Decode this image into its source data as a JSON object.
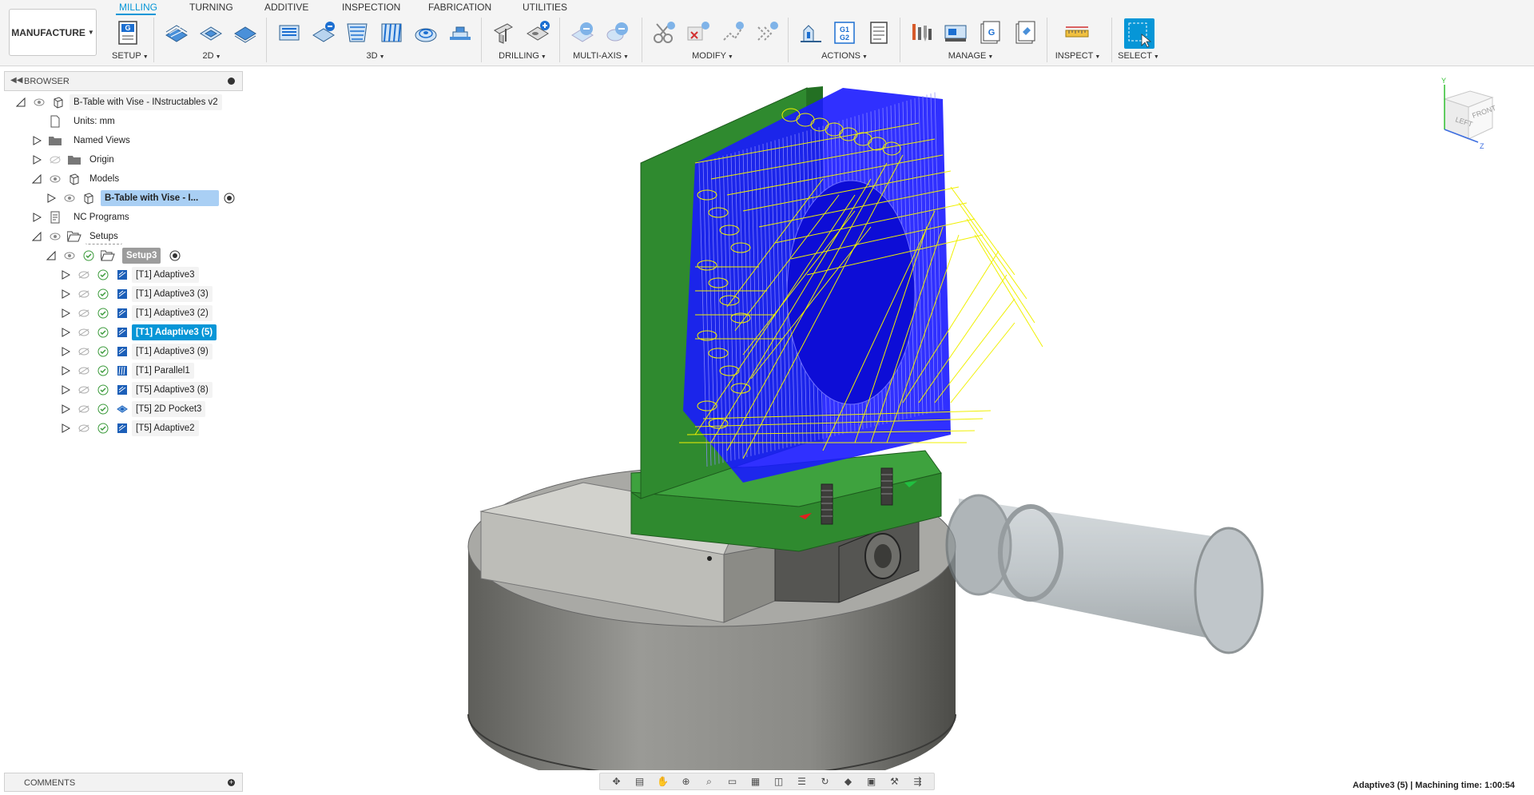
{
  "workspace": {
    "label": "MANUFACTURE"
  },
  "tabs": [
    {
      "label": "MILLING",
      "active": true
    },
    {
      "label": "TURNING"
    },
    {
      "label": "ADDITIVE"
    },
    {
      "label": "INSPECTION"
    },
    {
      "label": "FABRICATION"
    },
    {
      "label": "UTILITIES"
    }
  ],
  "groups": {
    "setup": "SETUP",
    "twod": "2D",
    "threed": "3D",
    "drilling": "DRILLING",
    "multiaxis": "MULTI-AXIS",
    "modify": "MODIFY",
    "actions": "ACTIONS",
    "manage": "MANAGE",
    "inspect": "INSPECT",
    "select": "SELECT"
  },
  "toolbar_icons": {
    "g_setup": "G",
    "g1": "G1",
    "g2": "G2",
    "g_manage": "G"
  },
  "browser": {
    "title": "BROWSER",
    "root": "B-Table with Vise - INstructables v2",
    "units": "Units: mm",
    "named_views": "Named Views",
    "origin": "Origin",
    "models": "Models",
    "model_item": "B-Table with Vise - I...",
    "nc_programs": "NC Programs",
    "setups": "Setups",
    "setup3": "Setup3",
    "ops": [
      {
        "label": "[T1] Adaptive3",
        "kind": "adaptive"
      },
      {
        "label": "[T1] Adaptive3 (3)",
        "kind": "adaptive"
      },
      {
        "label": "[T1] Adaptive3 (2)",
        "kind": "adaptive"
      },
      {
        "label": "[T1] Adaptive3 (5)",
        "kind": "adaptive",
        "selected": true
      },
      {
        "label": "[T1] Adaptive3 (9)",
        "kind": "adaptive"
      },
      {
        "label": "[T1] Parallel1",
        "kind": "parallel"
      },
      {
        "label": "[T5] Adaptive3 (8)",
        "kind": "adaptive"
      },
      {
        "label": "[T5] 2D Pocket3",
        "kind": "pocket"
      },
      {
        "label": "[T5] Adaptive2",
        "kind": "adaptive"
      }
    ]
  },
  "viewcube": {
    "left": "LEFT",
    "front": "FRONT",
    "axis_y": "Y",
    "axis_z": "Z"
  },
  "comments": {
    "title": "COMMENTS"
  },
  "status": {
    "text": "Adaptive3 (5) | Machining time: 1:00:54"
  },
  "colors": {
    "accent": "#0696d7",
    "part_green": "#2f8a2f",
    "toolpath_blue": "#1a1aff",
    "toolpath_yellow": "#f0f000",
    "stock_grey": "#8a8a86"
  }
}
